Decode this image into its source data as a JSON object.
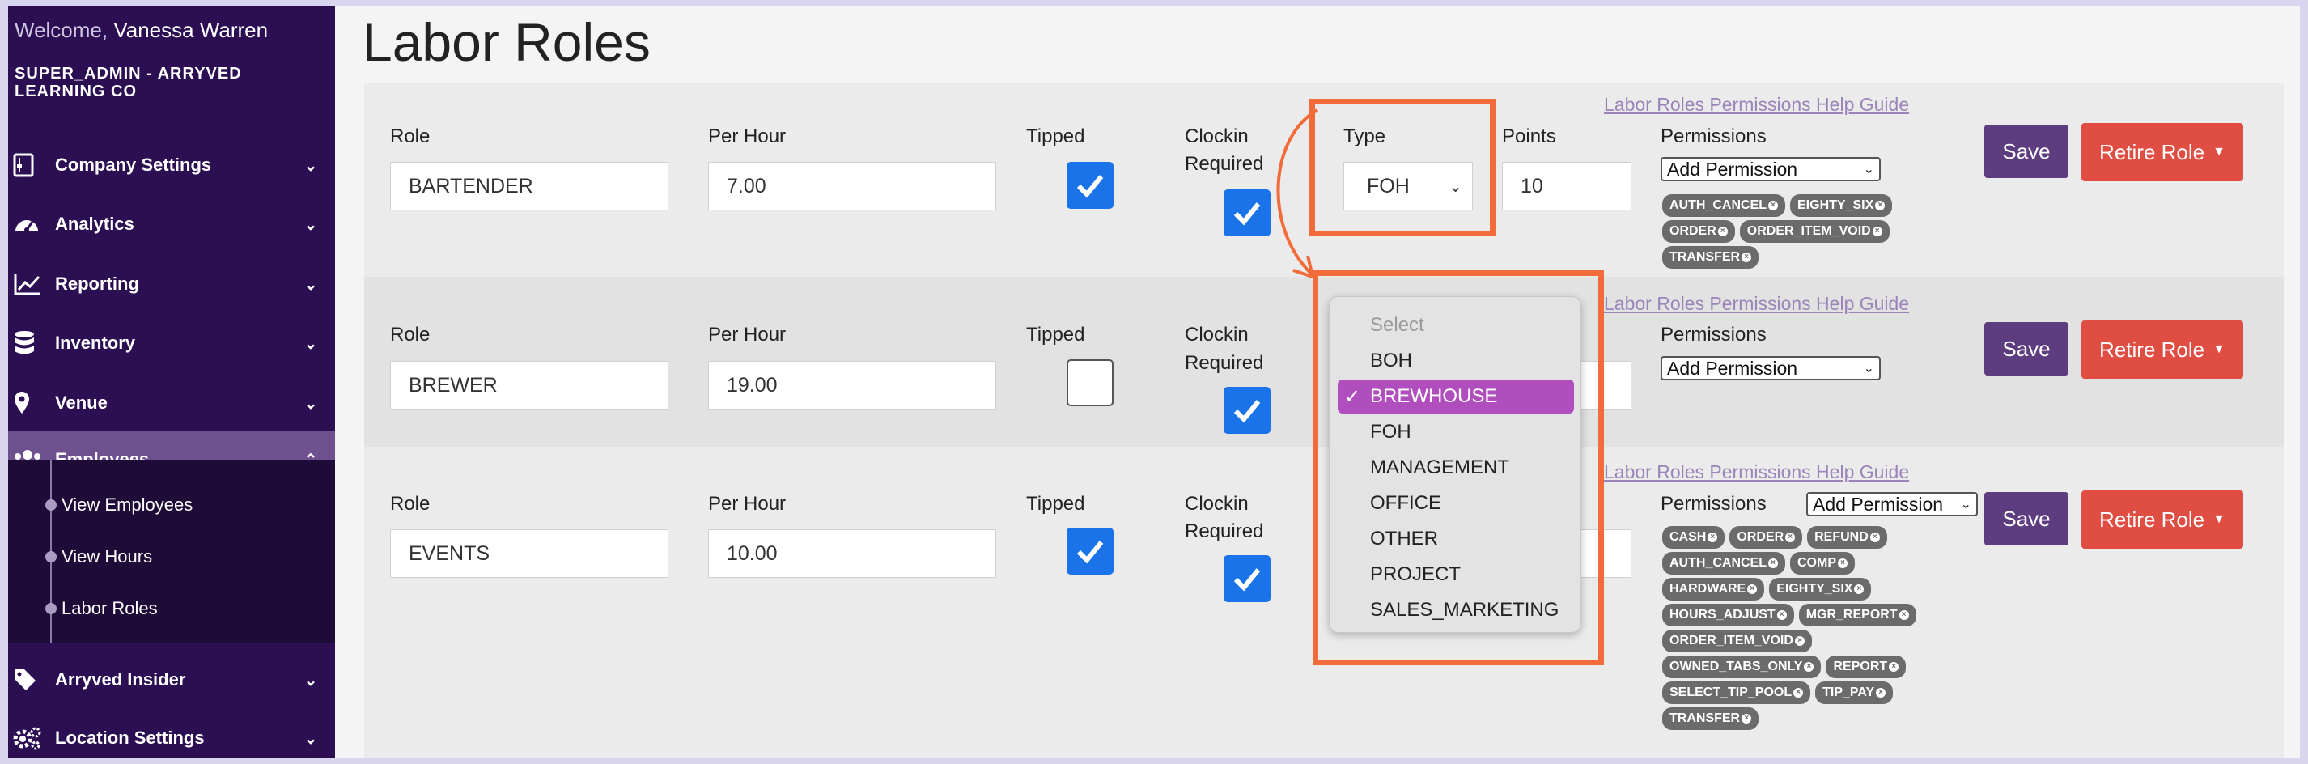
{
  "sidebar": {
    "welcome_prefix": "Welcome,",
    "welcome_name": "Vanessa Warren",
    "org": "SUPER_ADMIN - ARRYVED LEARNING CO",
    "items": [
      {
        "label": "Company Settings",
        "icon": "sliders-icon"
      },
      {
        "label": "Analytics",
        "icon": "gauge-icon"
      },
      {
        "label": "Reporting",
        "icon": "line-chart-icon"
      },
      {
        "label": "Inventory",
        "icon": "database-icon"
      },
      {
        "label": "Venue",
        "icon": "map-pin-icon"
      },
      {
        "label": "Employees",
        "icon": "users-icon"
      },
      {
        "label": "Arryved Insider",
        "icon": "tag-icon"
      },
      {
        "label": "Location Settings",
        "icon": "cogs-icon"
      }
    ],
    "subitems": [
      {
        "label": "View Employees"
      },
      {
        "label": "View Hours"
      },
      {
        "label": "Labor Roles"
      }
    ]
  },
  "page": {
    "title": "Labor Roles"
  },
  "labels": {
    "role": "Role",
    "per_hour": "Per Hour",
    "tipped": "Tipped",
    "clockin": "Clockin",
    "required": "Required",
    "type": "Type",
    "points": "Points",
    "permissions": "Permissions",
    "help": "Labor Roles Permissions Help Guide",
    "add_permission": "Add Permission",
    "save": "Save",
    "retire": "Retire Role"
  },
  "roles": [
    {
      "role": "BARTENDER",
      "per_hour": "7.00",
      "tipped": true,
      "clockin": true,
      "type": "FOH",
      "points": "10",
      "permissions": [
        "AUTH_CANCEL",
        "EIGHTY_SIX",
        "ORDER",
        "ORDER_ITEM_VOID",
        "TRANSFER"
      ]
    },
    {
      "role": "BREWER",
      "per_hour": "19.00",
      "tipped": false,
      "clockin": true,
      "permissions": []
    },
    {
      "role": "EVENTS",
      "per_hour": "10.00",
      "tipped": true,
      "clockin": true,
      "permissions": [
        "CASH",
        "ORDER",
        "REFUND",
        "AUTH_CANCEL",
        "COMP",
        "HARDWARE",
        "EIGHTY_SIX",
        "HOURS_ADJUST",
        "MGR_REPORT",
        "ORDER_ITEM_VOID",
        "OWNED_TABS_ONLY",
        "REPORT",
        "SELECT_TIP_POOL",
        "TIP_PAY",
        "TRANSFER"
      ]
    }
  ],
  "dropdown": {
    "options": [
      "Select",
      "BOH",
      "BREWHOUSE",
      "FOH",
      "MANAGEMENT",
      "OFFICE",
      "OTHER",
      "PROJECT",
      "SALES_MARKETING"
    ],
    "selected": "BREWHOUSE"
  },
  "colors": {
    "sidebar_bg": "#2b0f52",
    "accent_purple": "#5d3d80",
    "danger": "#e04d42",
    "checkbox_blue": "#1a73e8",
    "annotation_orange": "#f26b3a",
    "dropdown_highlight": "#b14ebd"
  }
}
